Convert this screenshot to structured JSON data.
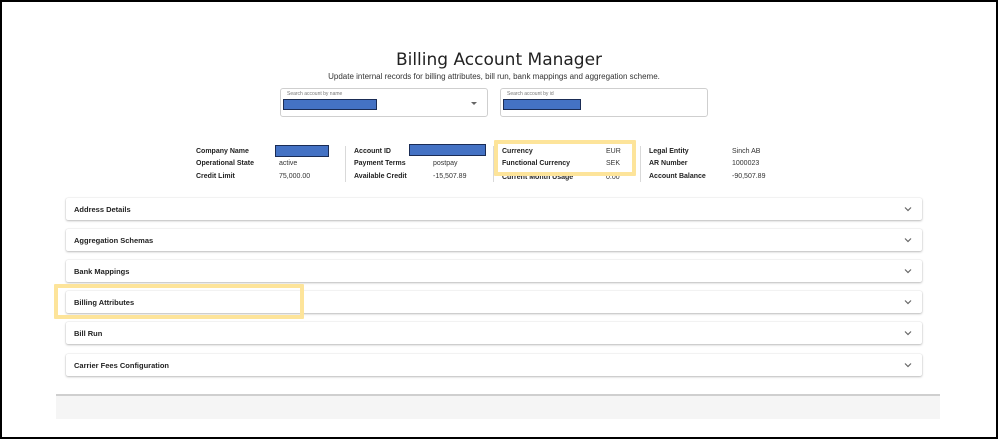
{
  "header": {
    "title": "Billing Account Manager",
    "subtitle": "Update internal records for billing attributes, bill run, bank mappings and aggregation scheme."
  },
  "search": {
    "by_name_label": "Search account by name",
    "by_id_label": "Search account by id"
  },
  "summary": {
    "col1": [
      {
        "label": "Company Name",
        "value": ""
      },
      {
        "label": "Operational State",
        "value": "active"
      },
      {
        "label": "Credit Limit",
        "value": "75,000.00"
      }
    ],
    "col2": [
      {
        "label": "Account ID",
        "value": ""
      },
      {
        "label": "Payment Terms",
        "value": "postpay"
      },
      {
        "label": "Available Credit",
        "value": "-15,507.89"
      }
    ],
    "col3": [
      {
        "label": "Currency",
        "value": "EUR"
      },
      {
        "label": "Functional Currency",
        "value": "SEK"
      },
      {
        "label": "Current Month Usage",
        "value": "0.00"
      }
    ],
    "col4": [
      {
        "label": "Legal Entity",
        "value": "Sinch AB"
      },
      {
        "label": "AR Number",
        "value": "1000023"
      },
      {
        "label": "Account Balance",
        "value": "-90,507.89"
      }
    ]
  },
  "panels": [
    {
      "label": "Address Details"
    },
    {
      "label": "Aggregation Schemas"
    },
    {
      "label": "Bank Mappings"
    },
    {
      "label": "Billing Attributes"
    },
    {
      "label": "Bill Run"
    },
    {
      "label": "Carrier Fees Configuration"
    }
  ],
  "icons": {
    "expand": "chevron-down-icon",
    "dropdown": "caret-down-icon"
  },
  "colors": {
    "highlight": "#fde49a",
    "redaction": "#4472c4"
  }
}
